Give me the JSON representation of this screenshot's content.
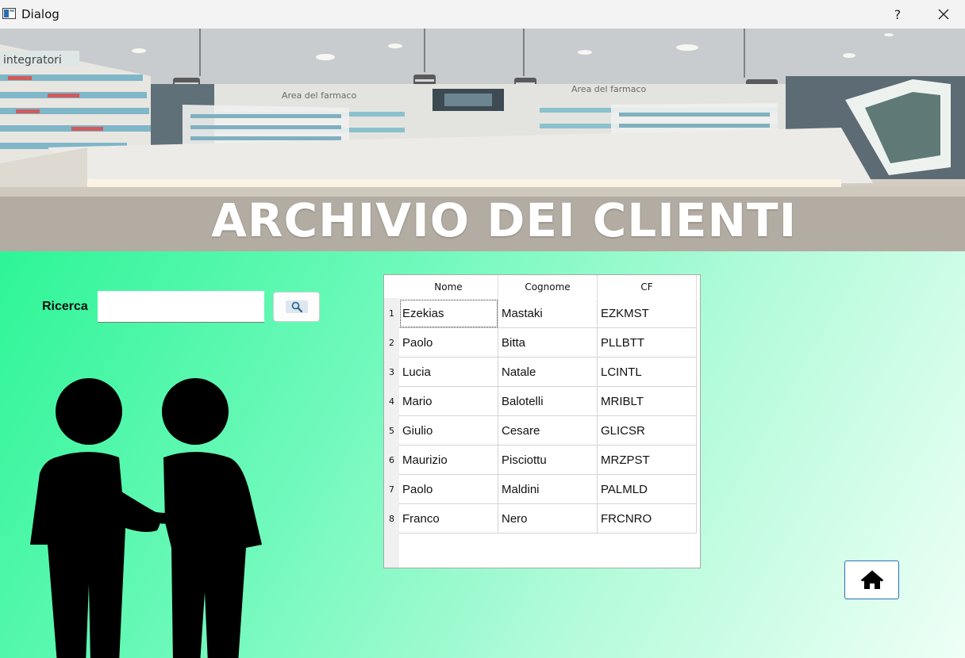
{
  "window": {
    "title": "Dialog",
    "help_label": "?",
    "close_icon": "close-icon"
  },
  "banner": {
    "title": "ARCHIVIO DEI CLIENTI",
    "image": "pharmacy-interior-photo"
  },
  "search": {
    "label": "Ricerca",
    "value": "",
    "placeholder": "",
    "button_icon": "search-icon"
  },
  "table": {
    "columns": [
      "Nome",
      "Cognome",
      "CF"
    ],
    "rows": [
      {
        "num": "1",
        "nome": "Ezekias",
        "cognome": "Mastaki",
        "cf": "EZKMST"
      },
      {
        "num": "2",
        "nome": "Paolo",
        "cognome": "Bitta",
        "cf": "PLLBTT"
      },
      {
        "num": "3",
        "nome": "Lucia",
        "cognome": "Natale",
        "cf": "LCINTL"
      },
      {
        "num": "4",
        "nome": "Mario",
        "cognome": "Balotelli",
        "cf": "MRIBLT"
      },
      {
        "num": "5",
        "nome": "Giulio",
        "cognome": "Cesare",
        "cf": "GLICSR"
      },
      {
        "num": "6",
        "nome": "Maurizio",
        "cognome": "Pisciottu",
        "cf": "MRZPST"
      },
      {
        "num": "7",
        "nome": "Paolo",
        "cognome": "Maldini",
        "cf": "PALMLD"
      },
      {
        "num": "8",
        "nome": "Franco",
        "cognome": "Nero",
        "cf": "FRCNRO"
      }
    ]
  },
  "home_button": {
    "icon": "home-icon"
  },
  "illustration": {
    "icon": "handshake-people-icon"
  },
  "colors": {
    "background_start": "#2ef597",
    "background_end": "#effff7",
    "home_border": "#2a6fb5"
  }
}
